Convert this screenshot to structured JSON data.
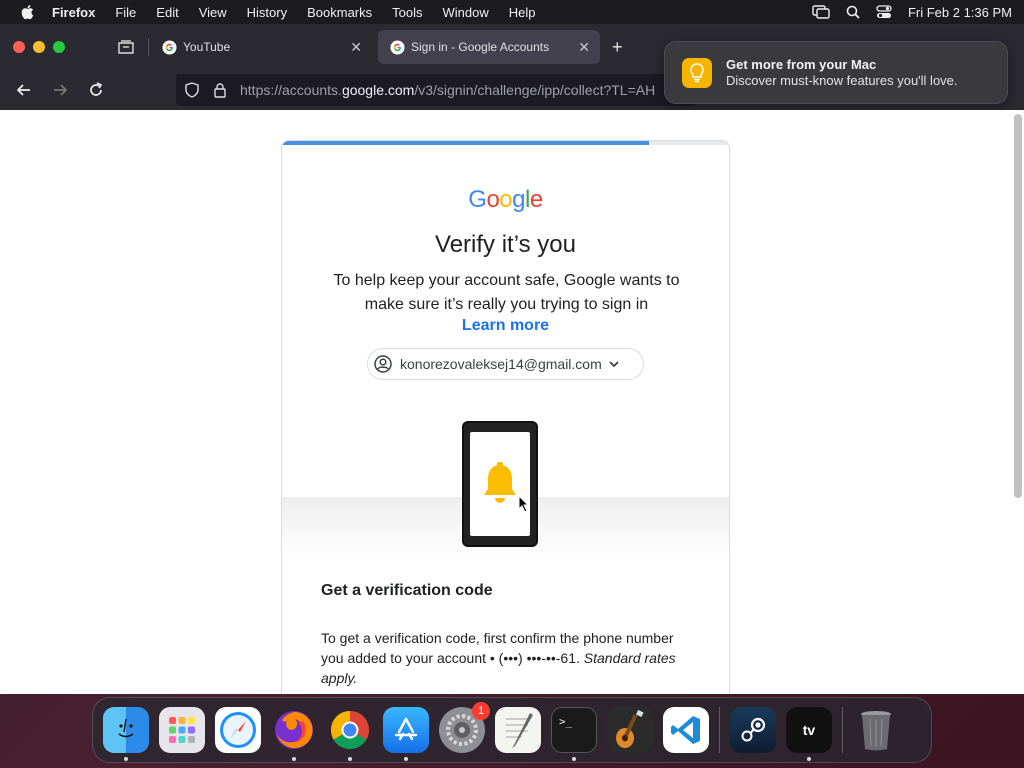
{
  "menubar": {
    "app": "Firefox",
    "items": [
      "File",
      "Edit",
      "View",
      "History",
      "Bookmarks",
      "Tools",
      "Window",
      "Help"
    ],
    "clock": "Fri Feb 2  1:36 PM"
  },
  "tabs": [
    {
      "title": "YouTube",
      "active": false
    },
    {
      "title": "Sign in - Google Accounts",
      "active": true
    }
  ],
  "urlbar": {
    "prefix": "https://accounts.",
    "host": "google.com",
    "path": "/v3/signin/challenge/ipp/collect?TL=AH"
  },
  "notification": {
    "title": "Get more from your Mac",
    "body": "Discover must-know features you'll love."
  },
  "page": {
    "progress_fraction": 0.82,
    "logo": [
      "G",
      "o",
      "o",
      "g",
      "l",
      "e"
    ],
    "logo_colors": [
      "#4285f4",
      "#ea4335",
      "#fbbc05",
      "#4285f4",
      "#34a853",
      "#ea4335"
    ],
    "heading": "Verify it’s you",
    "subtext": "To help keep your account safe, Google wants to make sure it’s really you trying to sign in",
    "learn_more": "Learn more",
    "account_email": "konorezovaleksej14@gmail.com",
    "section_title": "Get a verification code",
    "desc_main": "To get a verification code, first confirm the phone number you added to your account • (•••) •••-••-61. ",
    "desc_em": "Standard rates apply."
  },
  "dock": {
    "badge_count": "1",
    "apps": [
      "finder",
      "launchpad",
      "safari",
      "firefox",
      "chrome",
      "app-store",
      "system-settings",
      "textedit",
      "terminal",
      "garageband",
      "vscode",
      "steam",
      "apple-tv",
      "trash"
    ]
  },
  "colors": {
    "accent": "#1a73e8",
    "bell": "#fbbc04"
  }
}
